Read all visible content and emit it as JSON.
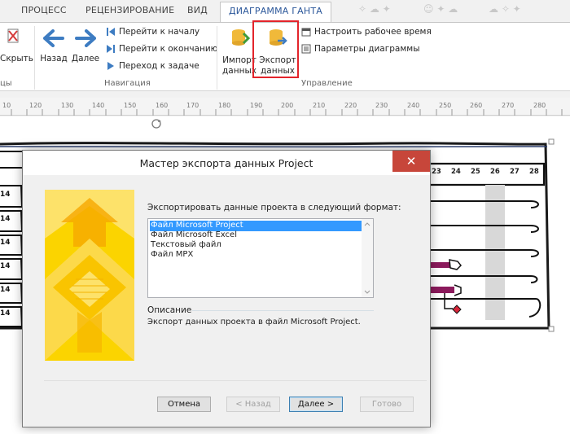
{
  "tabs": [
    "ПРОЦЕСС",
    "РЕЦЕНЗИРОВАНИЕ",
    "ВИД",
    "ДИАГРАММА ГАНТА"
  ],
  "active_tab": "ДИАГРАММА ГАНТА",
  "ribbon": {
    "edge_button_label": "Скрыть",
    "edge_group_label": "цы",
    "nav": {
      "back_label": "Назад",
      "forward_label": "Далее",
      "go_to_start": "Перейти к началу",
      "go_to_end": "Перейти к окончанию",
      "go_to_task": "Переход к задаче",
      "group_label": "Навигация"
    },
    "manage": {
      "import_label_1": "Импорт",
      "import_label_2": "данных",
      "export_label_1": "Экспорт",
      "export_label_2": "данных",
      "work_time": "Настроить рабочее время",
      "chart_params": "Параметры диаграммы",
      "group_label": "Управление"
    }
  },
  "ruler": {
    "ticks": [
      "10",
      "120",
      "130",
      "140",
      "150",
      "160",
      "170",
      "180",
      "190",
      "200",
      "210",
      "220",
      "230",
      "240",
      "250",
      "260",
      "270",
      "280"
    ]
  },
  "gantt": {
    "days": [
      "23",
      "24",
      "25",
      "26",
      "27",
      "28"
    ],
    "row_labels": [
      "14",
      "14",
      "14",
      "14",
      "14",
      "14"
    ]
  },
  "dialog": {
    "title": "Мастер экспорта данных Project",
    "close_glyph": "✕",
    "prompt": "Экспортировать данные проекта в следующий формат:",
    "formats": [
      "Файл Microsoft Project",
      "Файл Microsoft Excel",
      "Текстовый файл",
      "Файл MPX"
    ],
    "selected_format": "Файл Microsoft Project",
    "description_label": "Описание",
    "description_text": "Экспорт данных проекта в файл Microsoft Project.",
    "buttons": {
      "cancel": "Отмена",
      "back": "< Назад",
      "next": "Далее >",
      "finish": "Готово"
    }
  },
  "colors": {
    "accent_blue": "#2b579a",
    "highlight_red": "#e3242b",
    "selection_blue": "#3399ff",
    "close_red": "#c7463a",
    "wizard_yellow": "#f9d200",
    "gantt_bar": "#8b1a5c"
  }
}
